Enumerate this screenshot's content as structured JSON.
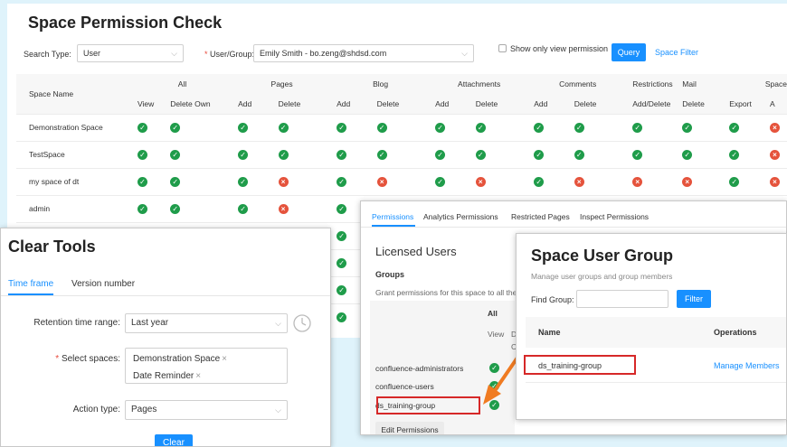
{
  "perm_check": {
    "title": "Space Permission Check",
    "search_type_label": "Search Type:",
    "search_type_value": "User",
    "user_group_label": "User/Group:",
    "user_group_value": "Emily Smith - bo.zeng@shdsd.com",
    "show_only_view_label": "Show only view permission",
    "query_label": "Query",
    "space_filter_label": "Space Filter",
    "col_space_name": "Space Name",
    "groups": [
      "All",
      "Pages",
      "Blog",
      "Attachments",
      "Comments",
      "Restrictions",
      "Mail",
      "Space"
    ],
    "subcols": [
      "View",
      "Delete Own",
      "Add",
      "Delete",
      "Add",
      "Delete",
      "Add",
      "Delete",
      "Add",
      "Delete",
      "Add/Delete",
      "Delete",
      "Export",
      "A"
    ],
    "rows": [
      {
        "name": "Demonstration Space",
        "cells": [
          "ok",
          "ok",
          "ok",
          "ok",
          "ok",
          "ok",
          "ok",
          "ok",
          "ok",
          "ok",
          "ok",
          "ok",
          "ok",
          "no"
        ]
      },
      {
        "name": "TestSpace",
        "cells": [
          "ok",
          "ok",
          "ok",
          "ok",
          "ok",
          "ok",
          "ok",
          "ok",
          "ok",
          "ok",
          "ok",
          "ok",
          "ok",
          "no"
        ]
      },
      {
        "name": "my space of dt",
        "cells": [
          "ok",
          "ok",
          "ok",
          "no",
          "ok",
          "no",
          "ok",
          "no",
          "ok",
          "no",
          "no",
          "no",
          "ok",
          "no"
        ]
      },
      {
        "name": "admin",
        "cells": [
          "ok",
          "ok",
          "ok",
          "no",
          "ok",
          "",
          "",
          "",
          "",
          "",
          "",
          "",
          "",
          ""
        ]
      },
      {
        "name": "",
        "cells": [
          "",
          "",
          "",
          "",
          "ok",
          "",
          "",
          "",
          "",
          "",
          "",
          "",
          "",
          ""
        ]
      },
      {
        "name": "",
        "cells": [
          "",
          "",
          "",
          "",
          "ok",
          "",
          "",
          "",
          "",
          "",
          "",
          "",
          "",
          ""
        ]
      },
      {
        "name": "",
        "cells": [
          "",
          "",
          "",
          "",
          "ok",
          "",
          "",
          "",
          "",
          "",
          "",
          "",
          "",
          ""
        ]
      },
      {
        "name": "",
        "cells": [
          "",
          "",
          "",
          "",
          "ok",
          "",
          "",
          "",
          "",
          "",
          "",
          "",
          "",
          ""
        ]
      }
    ]
  },
  "clear_tools": {
    "title": "Clear Tools",
    "tab_time_frame": "Time frame",
    "tab_version": "Version number",
    "retention_label": "Retention time range:",
    "retention_value": "Last year",
    "spaces_label": "Select spaces:",
    "spaces": [
      "Demonstration Space",
      "Date Reminder"
    ],
    "action_label": "Action type:",
    "action_value": "Pages",
    "clear_label": "Clear"
  },
  "permissions_panel": {
    "tabs": [
      "Permissions",
      "Analytics Permissions",
      "Restricted Pages",
      "Inspect Permissions"
    ],
    "licensed_users": "Licensed Users",
    "groups_heading": "Groups",
    "grant_text": "Grant permissions for this space to all the",
    "all_label": "All",
    "view_label": "View",
    "col_d": "D",
    "col_c": "C",
    "group_rows": [
      "confluence-administrators",
      "confluence-users",
      "ds_training-group"
    ],
    "edit_permissions": "Edit Permissions"
  },
  "user_group": {
    "title": "Space User Group",
    "subtitle": "Manage user groups and group members",
    "find_label": "Find Group:",
    "filter_label": "Filter",
    "col_name": "Name",
    "col_operations": "Operations",
    "row_name": "ds_training-group",
    "row_action": "Manage Members"
  },
  "colors": {
    "accent": "#1890ff",
    "ok": "#1f9c4a",
    "no": "#e5533c",
    "highlight": "#d62828",
    "arrow": "#f07b22"
  }
}
